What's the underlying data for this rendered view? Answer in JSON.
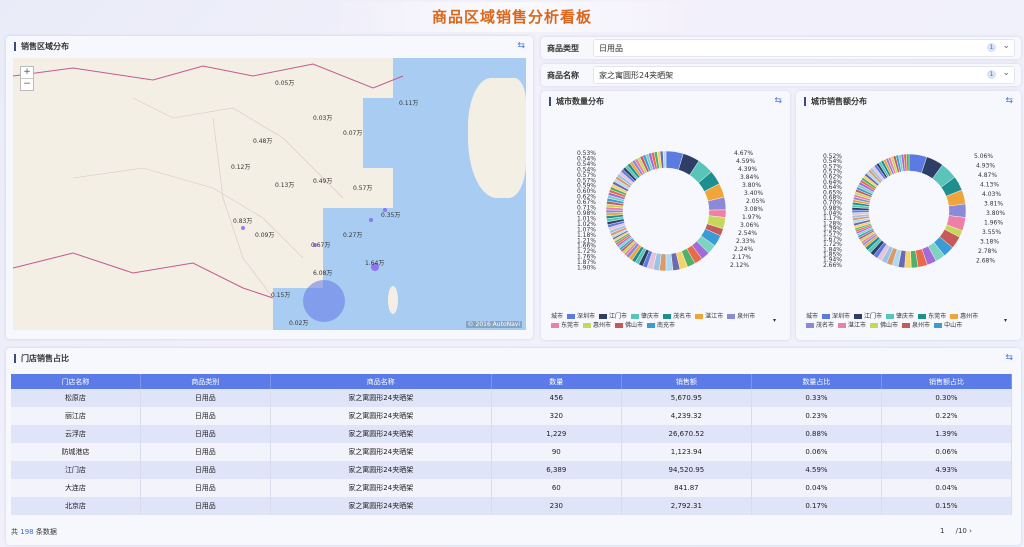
{
  "title": "商品区域销售分析看板",
  "map_panel": {
    "title": "销售区域分布",
    "zoom_in": "+",
    "zoom_out": "−",
    "copyright": "© 2016 AutoNavi",
    "value_labels": [
      "0.05万",
      "0.12万",
      "0.83万",
      "0.09万",
      "0.15万",
      "0.67万",
      "0.27万",
      "1.64万",
      "6.08万",
      "0.35万",
      "0.48万",
      "0.03万",
      "0.07万",
      "0.11万",
      "0.49万",
      "0.57万",
      "0.13万",
      "0.02万"
    ]
  },
  "filters": [
    {
      "label": "商品类型",
      "value": "日用品",
      "count": "1"
    },
    {
      "label": "商品名称",
      "value": "家之寓圆形24夹晒架",
      "count": "1"
    }
  ],
  "donut_qty": {
    "title": "城市数量分布",
    "labels_right": [
      "4.67%",
      "4.59%",
      "4.39%",
      "3.84%",
      "3.80%",
      "3.40%",
      "2.05%",
      "3.08%",
      "1.97%",
      "3.06%",
      "2.54%",
      "2.33%",
      "2.24%",
      "2.17%",
      "2.12%"
    ],
    "labels_left": [
      "0.53%",
      "0.54%",
      "0.54%",
      "0.54%",
      "0.57%",
      "0.57%",
      "0.59%",
      "0.60%",
      "0.62%",
      "0.67%",
      "0.71%",
      "0.98%",
      "1.01%",
      "1.02%",
      "1.07%",
      "1.18%",
      "1.21%",
      "1.66%",
      "1.72%",
      "1.76%",
      "1.87%",
      "1.90%"
    ],
    "legend_title": "城市",
    "legend": [
      "深圳市",
      "江门市",
      "肇庆市",
      "茂名市",
      "湛江市",
      "泉州市",
      "东莞市",
      "惠州市",
      "佛山市",
      "南充市"
    ]
  },
  "donut_amt": {
    "title": "城市销售额分布",
    "labels_right": [
      "5.06%",
      "4.93%",
      "4.87%",
      "4.13%",
      "4.03%",
      "3.81%",
      "3.80%",
      "1.96%",
      "3.55%",
      "3.18%",
      "2.78%",
      "2.68%"
    ],
    "labels_left": [
      "0.52%",
      "0.54%",
      "0.57%",
      "0.57%",
      "0.62%",
      "0.64%",
      "0.64%",
      "0.65%",
      "0.68%",
      "0.70%",
      "0.98%",
      "1.04%",
      "1.17%",
      "1.28%",
      "1.39%",
      "1.57%",
      "1.67%",
      "1.72%",
      "1.84%",
      "1.85%",
      "1.94%",
      "2.66%"
    ],
    "legend_title": "城市",
    "legend": [
      "深圳市",
      "江门市",
      "肇庆市",
      "东莞市",
      "惠州市",
      "茂名市",
      "湛江市",
      "佛山市",
      "泉州市",
      "中山市"
    ]
  },
  "table_panel": {
    "title": "门店销售占比",
    "headers": [
      "门店名称",
      "商品类别",
      "商品名称",
      "数量",
      "销售额",
      "数量占比",
      "销售额占比"
    ],
    "rows": [
      [
        "松原店",
        "日用品",
        "家之寓圆形24夹晒架",
        "456",
        "5,670.95",
        "0.33%",
        "0.30%"
      ],
      [
        "丽江店",
        "日用品",
        "家之寓圆形24夹晒架",
        "320",
        "4,239.32",
        "0.23%",
        "0.22%"
      ],
      [
        "云浮店",
        "日用品",
        "家之寓圆形24夹晒架",
        "1,229",
        "26,670.52",
        "0.88%",
        "1.39%"
      ],
      [
        "防城港店",
        "日用品",
        "家之寓圆形24夹晒架",
        "90",
        "1,123.94",
        "0.06%",
        "0.06%"
      ],
      [
        "江门店",
        "日用品",
        "家之寓圆形24夹晒架",
        "6,389",
        "94,520.95",
        "4.59%",
        "4.93%"
      ],
      [
        "大连店",
        "日用品",
        "家之寓圆形24夹晒架",
        "60",
        "841.87",
        "0.04%",
        "0.04%"
      ],
      [
        "北京店",
        "日用品",
        "家之寓圆形24夹晒架",
        "230",
        "2,792.31",
        "0.17%",
        "0.15%"
      ]
    ],
    "footer_prefix": "共",
    "footer_count": "198",
    "footer_suffix": "条数据",
    "page_current": "1",
    "page_total": "/10"
  },
  "colors": {
    "accent": "#5a7be8",
    "title": "#d9671c",
    "donut": [
      "#5b7be3",
      "#2e3e66",
      "#5bc4b8",
      "#1e8f8f",
      "#f0a53a",
      "#8a8ad8",
      "#ee7fa5",
      "#c6d85a",
      "#c65a5a",
      "#3b9bd6",
      "#7dd3c0",
      "#a46ad8",
      "#e86a4a",
      "#4fb06a",
      "#f3d36a",
      "#6a6ab0",
      "#b0d8f0",
      "#d89b6a",
      "#9bc2e8",
      "#e8c2d8"
    ]
  }
}
